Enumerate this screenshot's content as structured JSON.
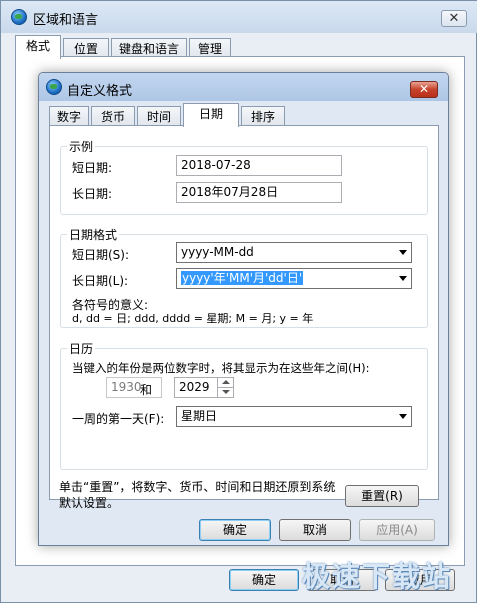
{
  "outer": {
    "title": "区域和语言",
    "tabs": [
      "格式",
      "位置",
      "键盘和语言",
      "管理"
    ],
    "ok_label": "确定",
    "cancel_label": "取消",
    "apply_label": "应用"
  },
  "dialog": {
    "title": "自定义格式",
    "tabs": [
      "数字",
      "货币",
      "时间",
      "日期",
      "排序"
    ],
    "example": {
      "group_label": "示例",
      "short_label": "短日期:",
      "short_value": "2018-07-28",
      "long_label": "长日期:",
      "long_value": "2018年07月28日"
    },
    "date_format": {
      "group_label": "日期格式",
      "short_label": "短日期(S):",
      "short_value": "yyyy-MM-dd",
      "long_label": "长日期(L):",
      "long_value": "yyyy'年'MM'月'dd'日'",
      "meaning_label": "各符号的意义:",
      "meaning_text": "d, dd = 日;  ddd, dddd = 星期;  M = 月;  y = 年"
    },
    "calendar": {
      "group_label": "日历",
      "two_digit_text": "当键入的年份是两位数字时，将其显示为在这些年之间(H):",
      "from_year": "1930",
      "and_label": "和",
      "to_year": "2029",
      "first_day_label": "一周的第一天(F):",
      "first_day_value": "星期日"
    },
    "reset_note": "单击“重置”，将数字、货币、时间和日期还原到系统默认设置。",
    "reset_label": "重置(R)",
    "ok_label": "确定",
    "cancel_label": "取消",
    "apply_label": "应用(A)"
  },
  "watermark": "极速下载站",
  "icons": {
    "app": "globe-icon",
    "close": "close-icon",
    "dropdown": "chevron-down-icon",
    "spin": "spinner-arrows-icon"
  }
}
